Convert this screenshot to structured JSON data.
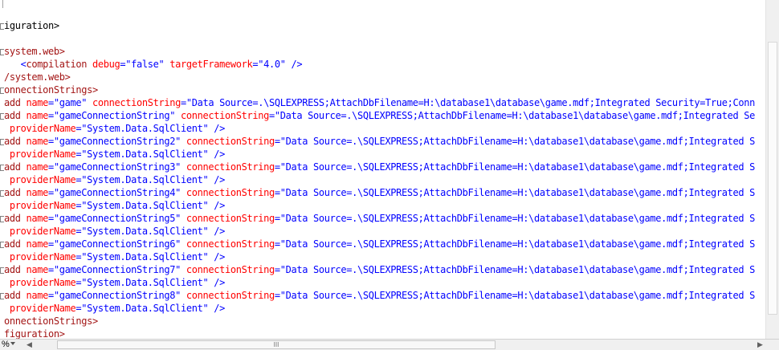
{
  "editor": {
    "lines": [
      {
        "fold": true,
        "segments": [
          {
            "t": "plain",
            "s": "iguration>"
          }
        ]
      },
      {
        "fold": false,
        "segments": []
      },
      {
        "fold": true,
        "segments": [
          {
            "t": "tag",
            "s": "system.web>"
          }
        ]
      },
      {
        "fold": false,
        "segments": [
          {
            "t": "punct",
            "s": "   <"
          },
          {
            "t": "tag",
            "s": "compilation"
          },
          {
            "t": "attr",
            "s": " debug"
          },
          {
            "t": "punct",
            "s": "="
          },
          {
            "t": "val",
            "s": "\"false\""
          },
          {
            "t": "attr",
            "s": " targetFramework"
          },
          {
            "t": "punct",
            "s": "="
          },
          {
            "t": "val",
            "s": "\"4.0\""
          },
          {
            "t": "punct",
            "s": " />"
          }
        ]
      },
      {
        "fold": false,
        "segments": [
          {
            "t": "tag",
            "s": "/system.web>"
          }
        ]
      },
      {
        "fold": true,
        "segments": [
          {
            "t": "tag",
            "s": "onnectionStrings>"
          }
        ]
      },
      {
        "fold": false,
        "segments": [
          {
            "t": "tag",
            "s": "add"
          },
          {
            "t": "attr",
            "s": " name"
          },
          {
            "t": "punct",
            "s": "="
          },
          {
            "t": "val",
            "s": "\"game\""
          },
          {
            "t": "attr",
            "s": " connectionString"
          },
          {
            "t": "punct",
            "s": "="
          },
          {
            "t": "val",
            "s": "\"Data Source=.\\SQLEXPRESS;AttachDbFilename=H:\\database1\\database\\game.mdf;Integrated Security=True;Conn"
          }
        ]
      },
      {
        "fold": true,
        "segments": [
          {
            "t": "tag",
            "s": "add"
          },
          {
            "t": "attr",
            "s": " name"
          },
          {
            "t": "punct",
            "s": "="
          },
          {
            "t": "val",
            "s": "\"gameConnectionString\""
          },
          {
            "t": "attr",
            "s": " connectionString"
          },
          {
            "t": "punct",
            "s": "="
          },
          {
            "t": "val",
            "s": "\"Data Source=.\\SQLEXPRESS;AttachDbFilename=H:\\database1\\database\\game.mdf;Integrated Se"
          }
        ]
      },
      {
        "fold": false,
        "segments": [
          {
            "t": "attr",
            "s": " providerName"
          },
          {
            "t": "punct",
            "s": "="
          },
          {
            "t": "val",
            "s": "\"System.Data.SqlClient\""
          },
          {
            "t": "punct",
            "s": " />"
          }
        ]
      },
      {
        "fold": true,
        "segments": [
          {
            "t": "tag",
            "s": "add"
          },
          {
            "t": "attr",
            "s": " name"
          },
          {
            "t": "punct",
            "s": "="
          },
          {
            "t": "val",
            "s": "\"gameConnectionString2\""
          },
          {
            "t": "attr",
            "s": " connectionString"
          },
          {
            "t": "punct",
            "s": "="
          },
          {
            "t": "val",
            "s": "\"Data Source=.\\SQLEXPRESS;AttachDbFilename=H:\\database1\\database\\game.mdf;Integrated S"
          }
        ]
      },
      {
        "fold": false,
        "segments": [
          {
            "t": "attr",
            "s": " providerName"
          },
          {
            "t": "punct",
            "s": "="
          },
          {
            "t": "val",
            "s": "\"System.Data.SqlClient\""
          },
          {
            "t": "punct",
            "s": " />"
          }
        ]
      },
      {
        "fold": true,
        "segments": [
          {
            "t": "tag",
            "s": "add"
          },
          {
            "t": "attr",
            "s": " name"
          },
          {
            "t": "punct",
            "s": "="
          },
          {
            "t": "val",
            "s": "\"gameConnectionString3\""
          },
          {
            "t": "attr",
            "s": " connectionString"
          },
          {
            "t": "punct",
            "s": "="
          },
          {
            "t": "val",
            "s": "\"Data Source=.\\SQLEXPRESS;AttachDbFilename=H:\\database1\\database\\game.mdf;Integrated S"
          }
        ]
      },
      {
        "fold": false,
        "segments": [
          {
            "t": "attr",
            "s": " providerName"
          },
          {
            "t": "punct",
            "s": "="
          },
          {
            "t": "val",
            "s": "\"System.Data.SqlClient\""
          },
          {
            "t": "punct",
            "s": " />"
          }
        ]
      },
      {
        "fold": true,
        "segments": [
          {
            "t": "tag",
            "s": "add"
          },
          {
            "t": "attr",
            "s": " name"
          },
          {
            "t": "punct",
            "s": "="
          },
          {
            "t": "val",
            "s": "\"gameConnectionString4\""
          },
          {
            "t": "attr",
            "s": " connectionString"
          },
          {
            "t": "punct",
            "s": "="
          },
          {
            "t": "val",
            "s": "\"Data Source=.\\SQLEXPRESS;AttachDbFilename=H:\\database1\\database\\game.mdf;Integrated S"
          }
        ]
      },
      {
        "fold": false,
        "segments": [
          {
            "t": "attr",
            "s": " providerName"
          },
          {
            "t": "punct",
            "s": "="
          },
          {
            "t": "val",
            "s": "\"System.Data.SqlClient\""
          },
          {
            "t": "punct",
            "s": " />"
          }
        ]
      },
      {
        "fold": true,
        "segments": [
          {
            "t": "tag",
            "s": "add"
          },
          {
            "t": "attr",
            "s": " name"
          },
          {
            "t": "punct",
            "s": "="
          },
          {
            "t": "val",
            "s": "\"gameConnectionString5\""
          },
          {
            "t": "attr",
            "s": " connectionString"
          },
          {
            "t": "punct",
            "s": "="
          },
          {
            "t": "val",
            "s": "\"Data Source=.\\SQLEXPRESS;AttachDbFilename=H:\\database1\\database\\game.mdf;Integrated S"
          }
        ]
      },
      {
        "fold": false,
        "segments": [
          {
            "t": "attr",
            "s": " providerName"
          },
          {
            "t": "punct",
            "s": "="
          },
          {
            "t": "val",
            "s": "\"System.Data.SqlClient\""
          },
          {
            "t": "punct",
            "s": " />"
          }
        ]
      },
      {
        "fold": true,
        "segments": [
          {
            "t": "tag",
            "s": "add"
          },
          {
            "t": "attr",
            "s": " name"
          },
          {
            "t": "punct",
            "s": "="
          },
          {
            "t": "val",
            "s": "\"gameConnectionString6\""
          },
          {
            "t": "attr",
            "s": " connectionString"
          },
          {
            "t": "punct",
            "s": "="
          },
          {
            "t": "val",
            "s": "\"Data Source=.\\SQLEXPRESS;AttachDbFilename=H:\\database1\\database\\game.mdf;Integrated S"
          }
        ]
      },
      {
        "fold": false,
        "segments": [
          {
            "t": "attr",
            "s": " providerName"
          },
          {
            "t": "punct",
            "s": "="
          },
          {
            "t": "val",
            "s": "\"System.Data.SqlClient\""
          },
          {
            "t": "punct",
            "s": " />"
          }
        ]
      },
      {
        "fold": true,
        "segments": [
          {
            "t": "tag",
            "s": "add"
          },
          {
            "t": "attr",
            "s": " name"
          },
          {
            "t": "punct",
            "s": "="
          },
          {
            "t": "val",
            "s": "\"gameConnectionString7\""
          },
          {
            "t": "attr",
            "s": " connectionString"
          },
          {
            "t": "punct",
            "s": "="
          },
          {
            "t": "val",
            "s": "\"Data Source=.\\SQLEXPRESS;AttachDbFilename=H:\\database1\\database\\game.mdf;Integrated S"
          }
        ]
      },
      {
        "fold": false,
        "segments": [
          {
            "t": "attr",
            "s": " providerName"
          },
          {
            "t": "punct",
            "s": "="
          },
          {
            "t": "val",
            "s": "\"System.Data.SqlClient\""
          },
          {
            "t": "punct",
            "s": " />"
          }
        ]
      },
      {
        "fold": true,
        "segments": [
          {
            "t": "tag",
            "s": "add"
          },
          {
            "t": "attr",
            "s": " name"
          },
          {
            "t": "punct",
            "s": "="
          },
          {
            "t": "val",
            "s": "\"gameConnectionString8\""
          },
          {
            "t": "attr",
            "s": " connectionString"
          },
          {
            "t": "punct",
            "s": "="
          },
          {
            "t": "val",
            "s": "\"Data Source=.\\SQLEXPRESS;AttachDbFilename=H:\\database1\\database\\game.mdf;Integrated S"
          }
        ]
      },
      {
        "fold": false,
        "segments": [
          {
            "t": "attr",
            "s": " providerName"
          },
          {
            "t": "punct",
            "s": "="
          },
          {
            "t": "val",
            "s": "\"System.Data.SqlClient\""
          },
          {
            "t": "punct",
            "s": " />"
          }
        ]
      },
      {
        "fold": false,
        "segments": [
          {
            "t": "tag",
            "s": "onnectionStrings>"
          }
        ]
      },
      {
        "fold": false,
        "segments": [
          {
            "t": "tag",
            "s": "figuration>"
          }
        ]
      }
    ]
  },
  "statusbar": {
    "zoom": "%",
    "hscroll_thumb_grip": "III",
    "left_arrow": "◀",
    "right_arrow": "▶"
  },
  "colors": {
    "tag": "#a31515",
    "attribute": "#ff0000",
    "value": "#0000ff",
    "background": "#ffffff"
  }
}
